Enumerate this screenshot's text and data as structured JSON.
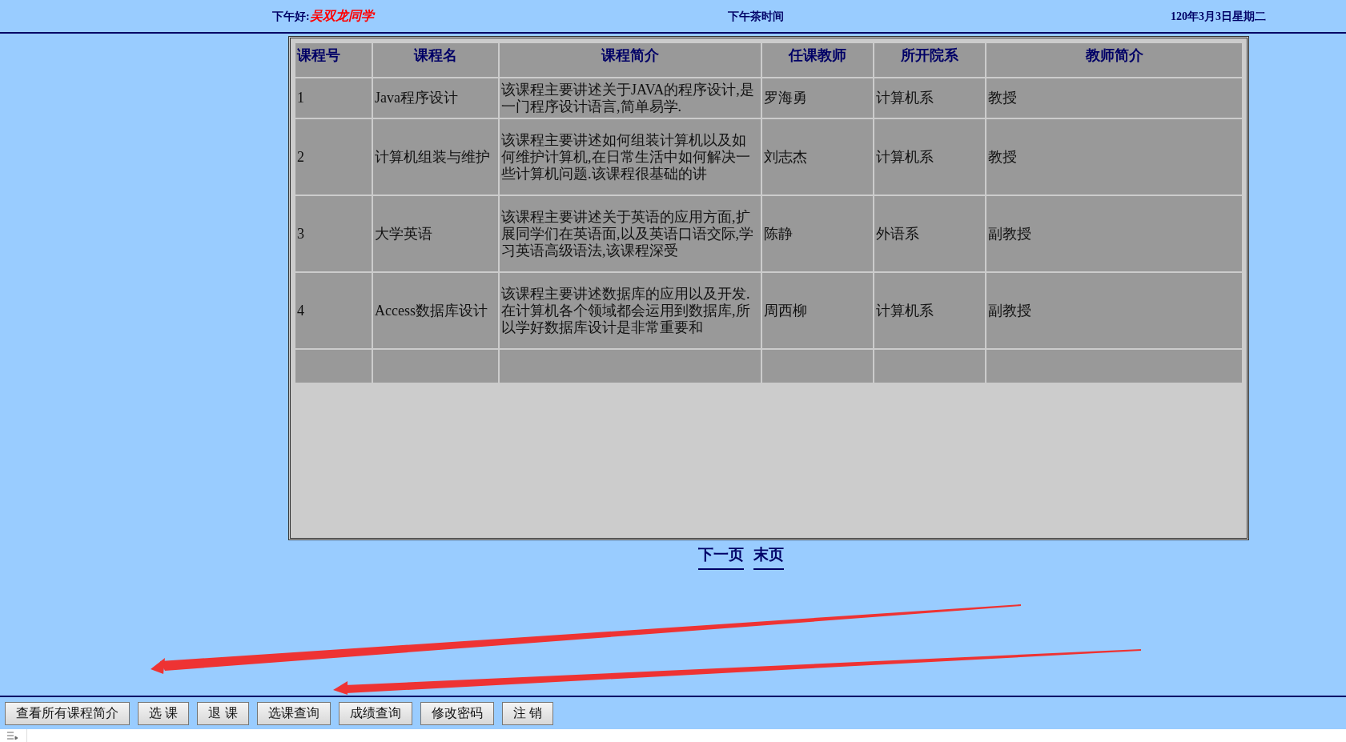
{
  "header": {
    "greeting": "下午好:",
    "user": "吴双龙同学",
    "title": "下午茶时间",
    "date": "120年3月3日星期二"
  },
  "table": {
    "columns": [
      "课程号",
      "课程名",
      "课程简介",
      "任课教师",
      "所开院系",
      "教师简介"
    ],
    "rows": [
      [
        "1",
        "Java程序设计",
        "该课程主要讲述关于JAVA的程序设计,是一门程序设计语言,简单易学.",
        "罗海勇",
        "计算机系",
        "教授"
      ],
      [
        "2",
        "计算机组装与维护",
        "该课程主要讲述如何组装计算机以及如何维护计算机,在日常生活中如何解决一些计算机问题.该课程很基础的讲",
        "刘志杰",
        "计算机系",
        "教授"
      ],
      [
        "3",
        "大学英语",
        "该课程主要讲述关于英语的应用方面,扩展同学们在英语面,以及英语口语交际,学习英语高级语法,该课程深受",
        "陈静",
        "外语系",
        "副教授"
      ],
      [
        "4",
        "Access数据库设计",
        "该课程主要讲述数据库的应用以及开发.在计算机各个领域都会运用到数据库,所以学好数据库设计是非常重要和",
        "周西柳",
        "计算机系",
        "副教授"
      ]
    ]
  },
  "pagination": [
    "下一页",
    "末页"
  ],
  "buttons": [
    "查看所有课程简介",
    "选 课",
    "退 课",
    "选课查询",
    "成绩查询",
    "修改密码",
    "注 销"
  ]
}
